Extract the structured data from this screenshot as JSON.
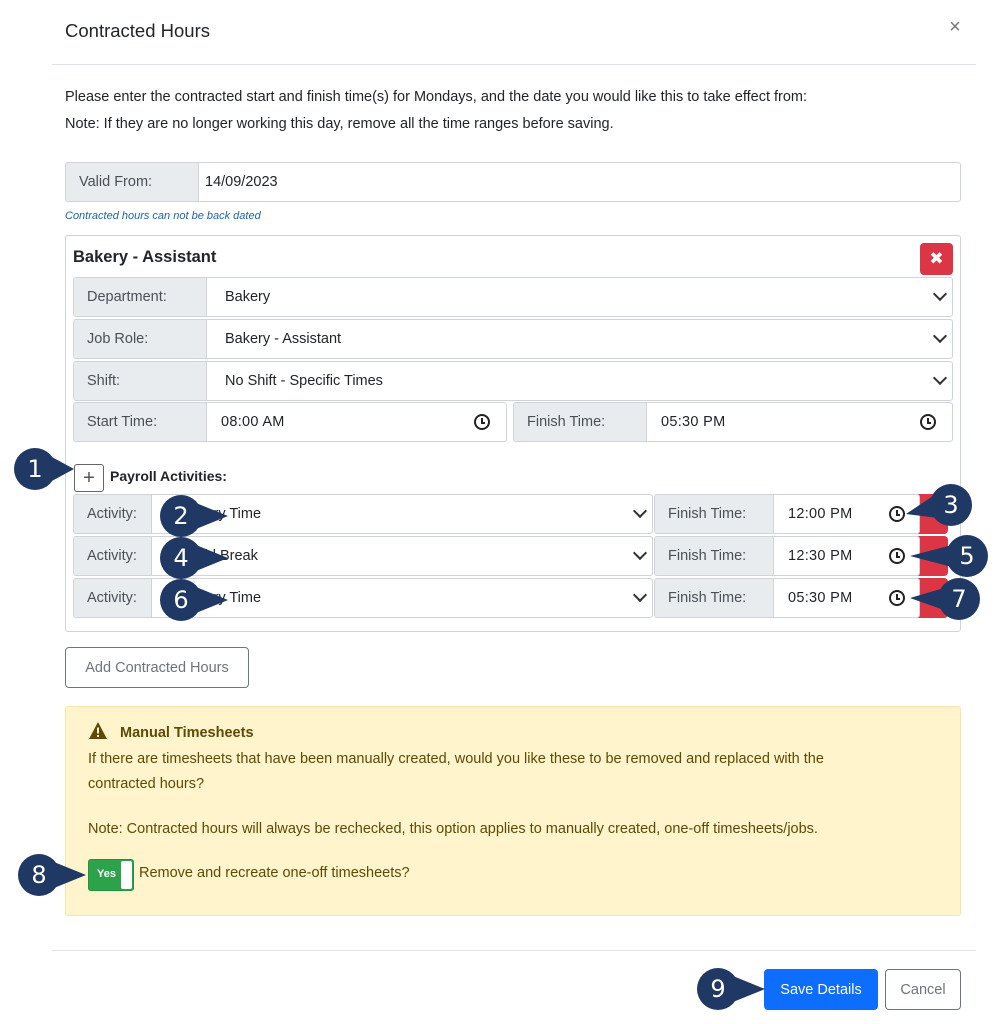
{
  "dialog": {
    "title": "Contracted Hours",
    "close_icon": "×"
  },
  "intro": {
    "line1": "Please enter the contracted start and finish time(s) for Mondays, and the date you would like this to take effect from:",
    "line2": "Note: If they are no longer working this day, remove all the time ranges before saving."
  },
  "valid_from": {
    "label": "Valid From:",
    "value": "14/09/2023",
    "hint": "Contracted hours can not be back dated"
  },
  "job": {
    "title": "Bakery - Assistant",
    "delete_icon": "✖",
    "department": {
      "label": "Department:",
      "value": "Bakery"
    },
    "job_role": {
      "label": "Job Role:",
      "value": "Bakery - Assistant"
    },
    "shift": {
      "label": "Shift:",
      "value": "No Shift - Specific Times"
    },
    "start_time": {
      "label": "Start Time:",
      "value": "08:00 AM"
    },
    "finish_time": {
      "label": "Finish Time:",
      "value": "05:30 PM"
    },
    "payroll_label": "Payroll Activities:",
    "add_activity_icon": "+",
    "activities": [
      {
        "label": "Activity:",
        "value": "Ordinary Time",
        "finish_label": "Finish Time:",
        "finish_value": "12:00 PM"
      },
      {
        "label": "Activity:",
        "value": "Unpaid Break",
        "finish_label": "Finish Time:",
        "finish_value": "12:30 PM"
      },
      {
        "label": "Activity:",
        "value": "Ordinary Time",
        "finish_label": "Finish Time:",
        "finish_value": "05:30 PM"
      }
    ]
  },
  "add_contracted_hours_label": "Add Contracted Hours",
  "manual_timesheets": {
    "title": "Manual Timesheets",
    "text_line1": "If there are timesheets that have been manually created, would you like these to be removed and replaced with the",
    "text_line2": "contracted hours?",
    "note": "Note: Contracted hours will always be rechecked, this option applies to manually created, one-off timesheets/jobs.",
    "toggle_label": "Yes",
    "toggle_text": "Remove and recreate one-off timesheets?"
  },
  "footer": {
    "save_label": "Save Details",
    "cancel_label": "Cancel"
  },
  "markers": [
    "1",
    "2",
    "3",
    "4",
    "5",
    "6",
    "7",
    "8",
    "9"
  ],
  "colors": {
    "primary": "#0d6efd",
    "danger": "#dc3545",
    "success": "#2ca34a",
    "warning_bg": "#fff4cc",
    "marker": "#1f3864"
  }
}
